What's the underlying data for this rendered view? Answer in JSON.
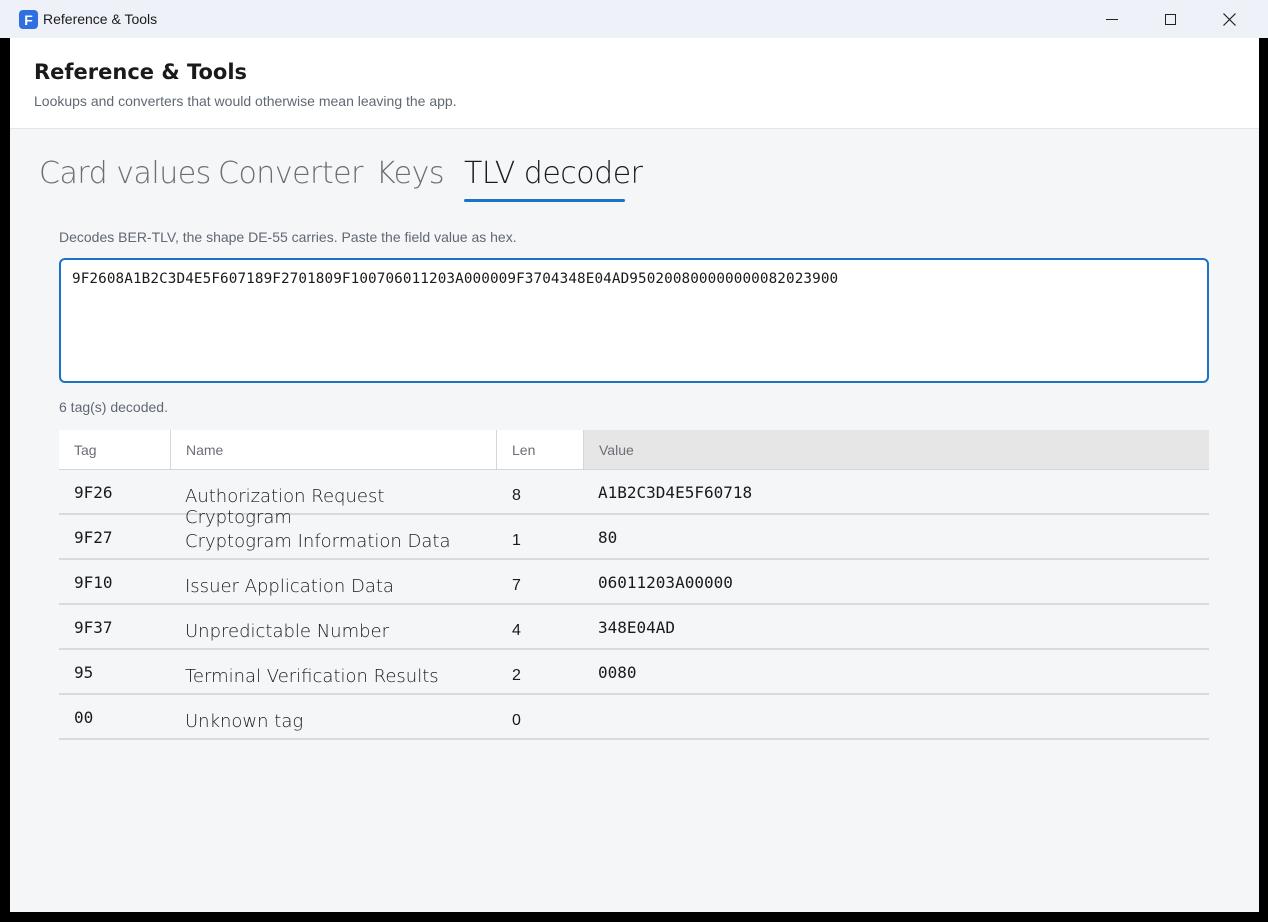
{
  "window": {
    "title": "Reference & Tools",
    "app_icon_letter": "F"
  },
  "header": {
    "title": "Reference & Tools",
    "subtitle": "Lookups and converters that would otherwise mean leaving the app."
  },
  "tabs": [
    {
      "label": "Card values",
      "active": false
    },
    {
      "label": "Converter",
      "active": false
    },
    {
      "label": "Keys",
      "active": false
    },
    {
      "label": "TLV decoder",
      "active": true
    }
  ],
  "tlv": {
    "hint": "Decodes BER-TLV, the shape DE-55 carries. Paste the field value as hex.",
    "input_value": "9F2608A1B2C3D4E5F607189F2701809F100706011203A000009F3704348E04AD950200800000000082023900",
    "status": "6 tag(s) decoded.",
    "columns": [
      "Tag",
      "Name",
      "Len",
      "Value"
    ],
    "rows": [
      {
        "tag": "9F26",
        "name": "Authorization Request Cryptogram",
        "len": "8",
        "value": "A1B2C3D4E5F60718"
      },
      {
        "tag": "9F27",
        "name": "Cryptogram Information Data",
        "len": "1",
        "value": "80"
      },
      {
        "tag": "9F10",
        "name": "Issuer Application Data",
        "len": "7",
        "value": "06011203A00000"
      },
      {
        "tag": "9F37",
        "name": "Unpredictable Number",
        "len": "4",
        "value": "348E04AD"
      },
      {
        "tag": "95",
        "name": "Terminal Verification Results",
        "len": "2",
        "value": "0080"
      },
      {
        "tag": "00",
        "name": "Unknown tag",
        "len": "0",
        "value": ""
      }
    ]
  },
  "colors": {
    "accent": "#1a73c7",
    "app_icon": "#2f6fe0"
  }
}
